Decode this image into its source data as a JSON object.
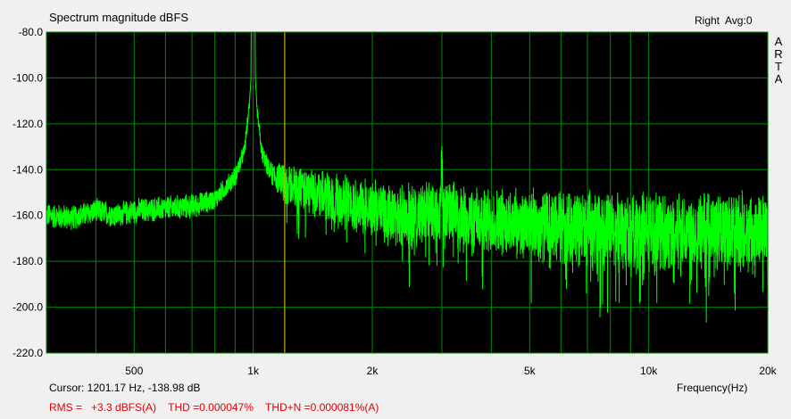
{
  "chart_data": {
    "type": "line",
    "title": "Spectrum magnitude dBFS",
    "xlabel": "Frequency(Hz)",
    "ylabel": "",
    "x_scale": "log",
    "xlim": [
      300,
      20000
    ],
    "ylim": [
      -220,
      -80
    ],
    "y_ticks": [
      -80,
      -100,
      -120,
      -140,
      -160,
      -180,
      -200,
      -220
    ],
    "y_tick_labels": [
      "-80.0",
      "-100.0",
      "-120.0",
      "-140.0",
      "-160.0",
      "-180.0",
      "-200.0",
      "-220.0"
    ],
    "x_ticks": [
      500,
      1000,
      2000,
      5000,
      10000,
      20000
    ],
    "x_tick_labels": [
      "500",
      "1k",
      "2k",
      "5k",
      "10k",
      "20k"
    ],
    "x_gridlines": [
      400,
      500,
      600,
      700,
      800,
      900,
      1000,
      2000,
      3000,
      4000,
      5000,
      6000,
      7000,
      8000,
      9000,
      10000,
      20000
    ],
    "grid": true,
    "cursor_x": 1201.17,
    "colors": {
      "plot_background": "#000000",
      "grid": "#008a00",
      "trace": "#00ff00",
      "cursor": "#c8b400"
    },
    "series": [
      {
        "x": [
          300,
          350,
          400,
          450,
          500,
          600,
          700,
          800,
          900,
          950,
          980,
          1000,
          1020,
          1050,
          1100,
          1200,
          1500,
          2000,
          2500,
          2980,
          3000,
          3020,
          3500,
          5000,
          7000,
          10000,
          15000,
          20000
        ],
        "y": [
          -160,
          -161,
          -158,
          -160,
          -158,
          -157,
          -156,
          -153,
          -143,
          -132,
          -110,
          -80,
          -112,
          -132,
          -141,
          -146,
          -152,
          -157,
          -160,
          -158,
          -125,
          -158,
          -162,
          -164,
          -166,
          -167,
          -166,
          -166
        ],
        "noise_db": [
          6,
          6,
          6,
          6,
          6,
          6,
          6,
          5,
          5,
          4,
          3,
          0,
          3,
          4,
          5,
          10,
          12,
          14,
          15,
          15,
          15,
          15,
          16,
          17,
          18,
          19,
          19,
          19
        ]
      }
    ]
  },
  "ui": {
    "channel_info": "Right  Avg:0",
    "brand": [
      "A",
      "R",
      "T",
      "A"
    ],
    "cursor_readout": "Cursor: 1201.17 Hz, -138.98 dB",
    "stats": "RMS =   +3.3 dBFS(A)    THD =0.000047%    THD+N =0.000081%(A)"
  }
}
